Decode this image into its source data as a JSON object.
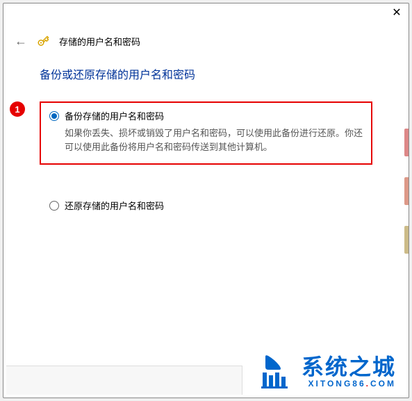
{
  "window": {
    "close_symbol": "✕"
  },
  "header": {
    "back_symbol": "←",
    "title": "存储的用户名和密码"
  },
  "main": {
    "heading": "备份或还原存储的用户名和密码"
  },
  "annotation": {
    "step": "1"
  },
  "options": {
    "backup": {
      "label": "备份存储的用户名和密码",
      "description": "如果你丢失、损坏或销毁了用户名和密码，可以使用此备份进行还原。你还可以使用此备份将用户名和密码传送到其他计算机。",
      "selected": true
    },
    "restore": {
      "label": "还原存储的用户名和密码",
      "selected": false
    }
  },
  "watermark": {
    "main_text": "系统之城",
    "sub_prefix": "XITONG86",
    "sub_dot": ".",
    "sub_suffix": "COM"
  },
  "colors": {
    "accent_blue": "#0067c0",
    "heading_blue": "#003399",
    "highlight_red": "#e60000",
    "brand_blue": "#0066cc"
  }
}
